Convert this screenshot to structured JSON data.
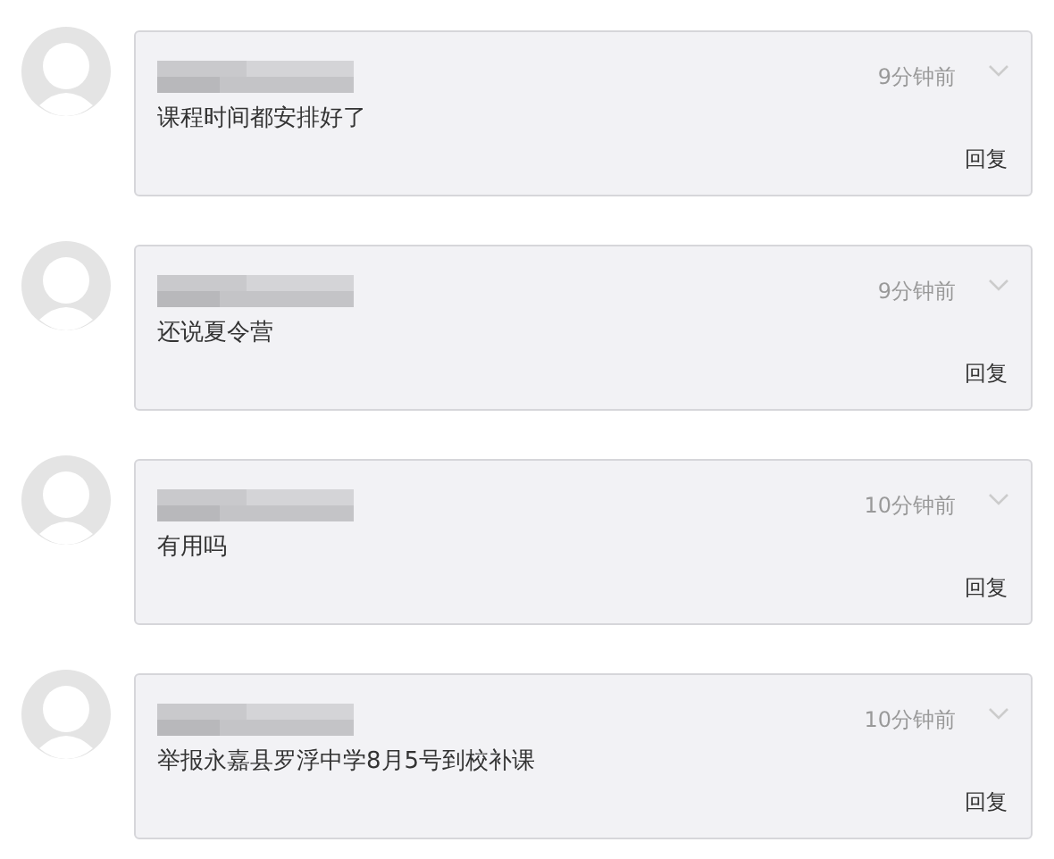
{
  "comments": [
    {
      "time": "9分钟前",
      "content": "课程时间都安排好了",
      "reply": "回复"
    },
    {
      "time": "9分钟前",
      "content": "还说夏令营",
      "reply": "回复"
    },
    {
      "time": "10分钟前",
      "content": "有用吗",
      "reply": "回复"
    },
    {
      "time": "10分钟前",
      "content": "举报永嘉县罗浮中学8月5号到校补课",
      "reply": "回复"
    }
  ]
}
